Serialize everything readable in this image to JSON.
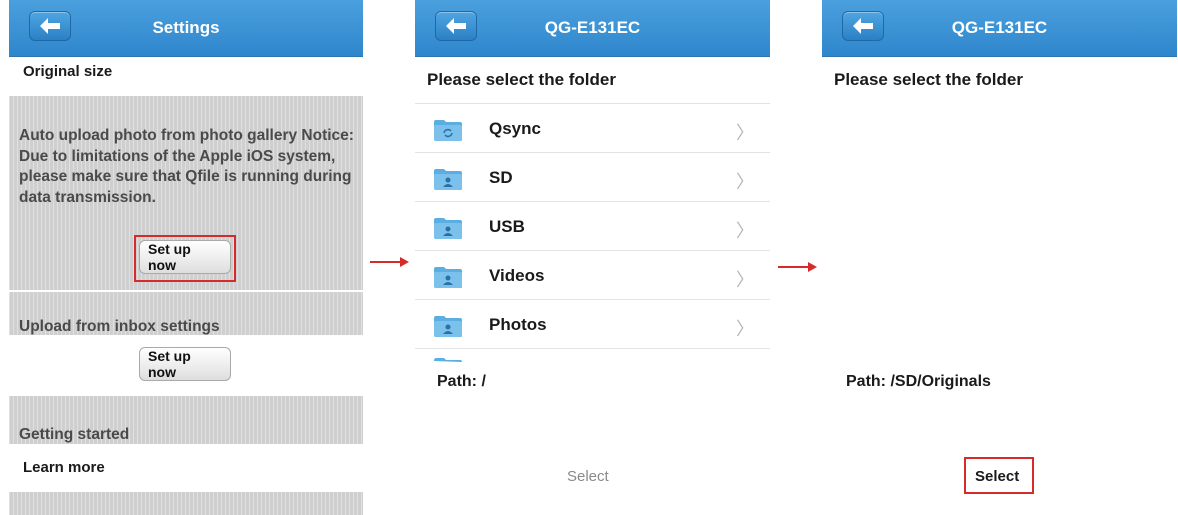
{
  "screen1": {
    "title": "Settings",
    "original_size": "Original size",
    "auto_upload_text": "Auto upload photo from photo gallery Notice: Due to limitations of the Apple iOS system, please make sure that Qfile is running during data transmission.",
    "setup_now_1": "Set up now",
    "inbox_heading": "Upload from inbox settings",
    "setup_now_2": "Set up now",
    "getting_started": "Getting started",
    "learn_more": "Learn more"
  },
  "screen2": {
    "title": "QG-E131EC",
    "heading": "Please select the folder",
    "folders": [
      {
        "label": "Qsync",
        "icon": "qsync-folder-icon"
      },
      {
        "label": "SD",
        "icon": "shared-folder-icon"
      },
      {
        "label": "USB",
        "icon": "shared-folder-icon"
      },
      {
        "label": "Videos",
        "icon": "shared-folder-icon"
      },
      {
        "label": "Photos",
        "icon": "shared-folder-icon"
      }
    ],
    "path": "Path: /",
    "select": "Select"
  },
  "screen3": {
    "title": "QG-E131EC",
    "heading": "Please select the folder",
    "path": "Path: /SD/Originals",
    "select": "Select"
  },
  "colors": {
    "navbar": "#3a94d6",
    "highlight": "#d62b2b",
    "gray_section": "#cfcfcf"
  }
}
